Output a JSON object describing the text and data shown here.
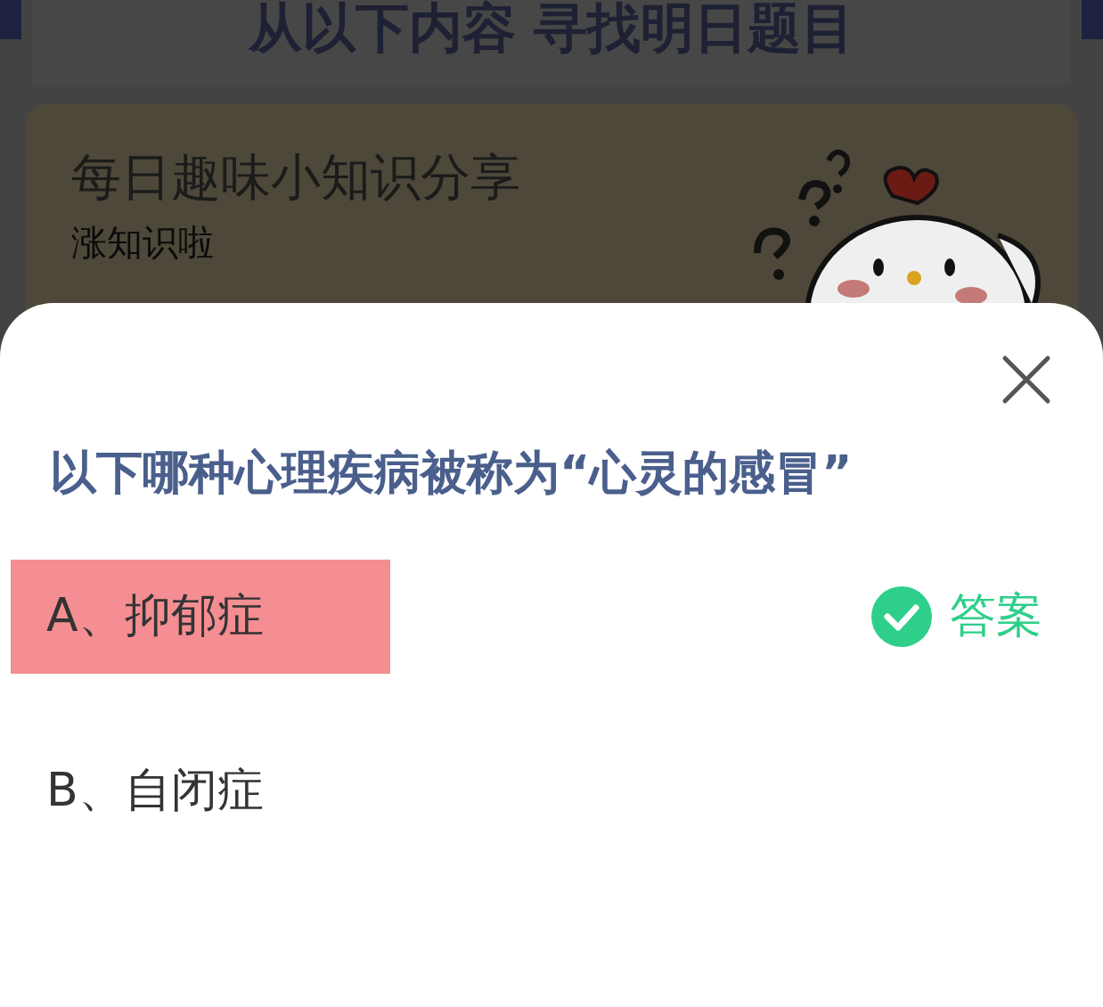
{
  "background": {
    "heading": "从以下内容 寻找明日题目",
    "card": {
      "title": "每日趣味小知识分享",
      "subtitle": "涨知识啦"
    }
  },
  "sheet": {
    "question": "以下哪种心理疾病被称为“心灵的感冒”",
    "options": [
      {
        "label": "A、抑郁症",
        "selected": true,
        "is_answer": true,
        "answer_label": "答案"
      },
      {
        "label": "B、自闭症",
        "selected": false,
        "is_answer": false
      }
    ]
  }
}
